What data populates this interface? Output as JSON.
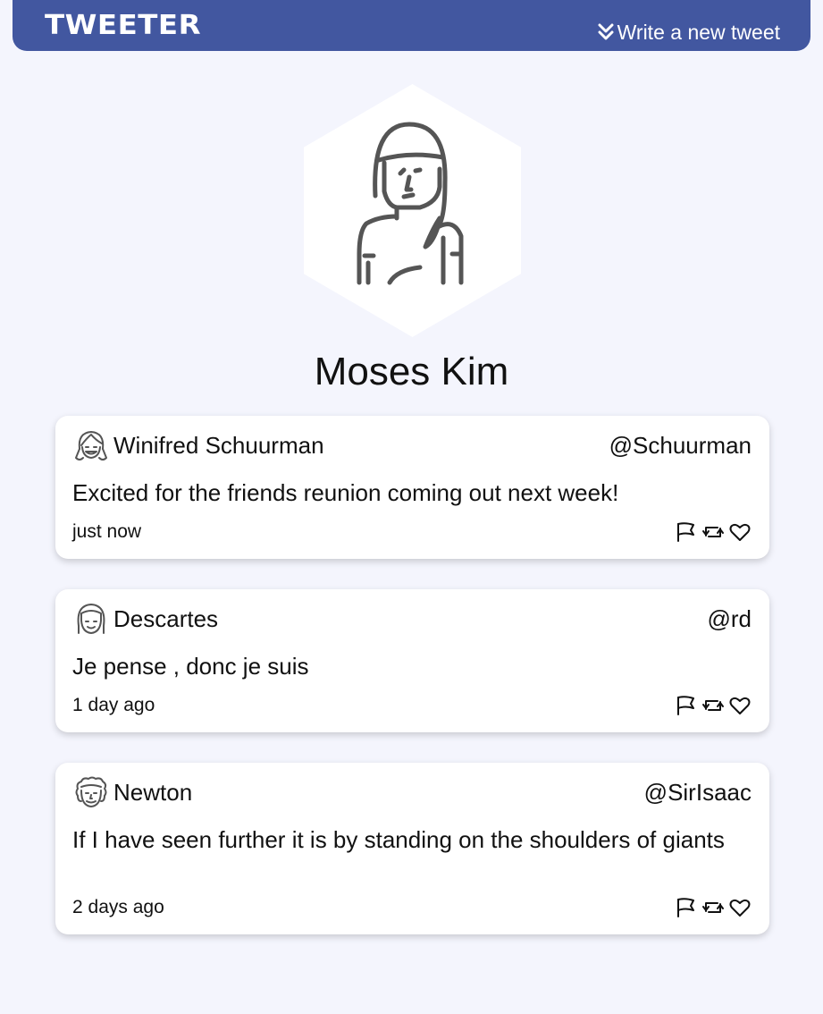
{
  "app": {
    "brand": "TWEETER",
    "compose_label": "Write a new tweet",
    "accent_color": "#4257a0",
    "background_color": "#f4f5fd"
  },
  "profile": {
    "name": "Moses Kim",
    "avatar_icon": "woman-avatar-icon"
  },
  "tweets": [
    {
      "name": "Winifred Schuurman",
      "handle": "@Schuurman",
      "text": "Excited for the friends reunion coming out next week!",
      "time": "just now",
      "avatar_icon": "smiling-girl-avatar-icon"
    },
    {
      "name": "Descartes",
      "handle": "@rd",
      "text": "Je pense , donc je suis",
      "time": "1 day ago",
      "avatar_icon": "bangs-avatar-icon"
    },
    {
      "name": "Newton",
      "handle": "@SirIsaac",
      "text": "If I have seen further it is by standing on the shoulders of giants",
      "time": "2 days ago",
      "avatar_icon": "curly-hair-avatar-icon"
    }
  ],
  "actions": {
    "flag_icon": "flag-icon",
    "retweet_icon": "retweet-icon",
    "like_icon": "heart-icon"
  }
}
